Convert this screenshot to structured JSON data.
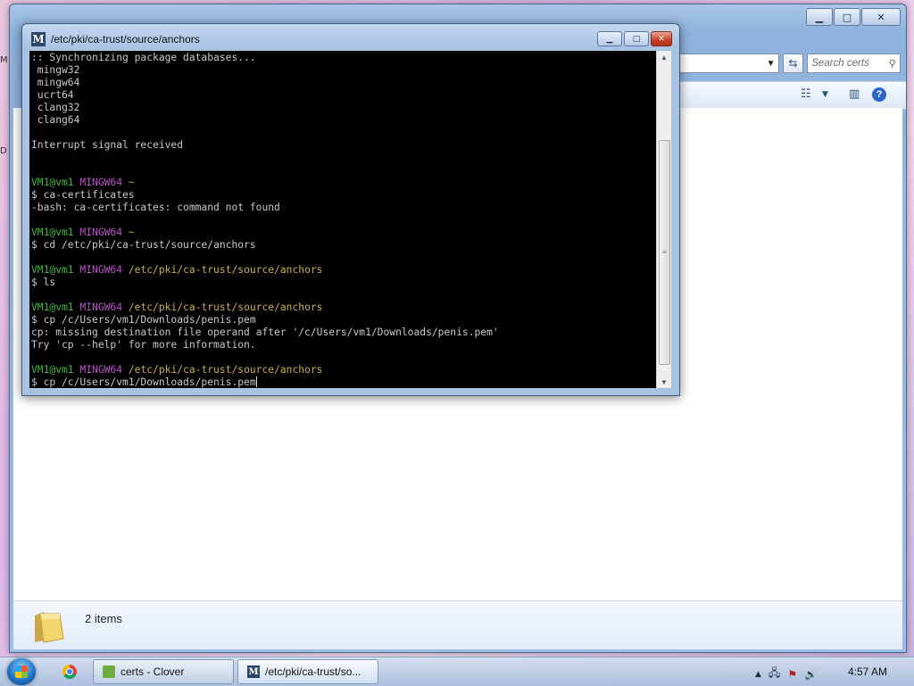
{
  "explorer": {
    "search_placeholder": "Search certs",
    "item_count": "2 items",
    "caption": {
      "minimize": "▁",
      "maximize": "□",
      "close": "✕"
    }
  },
  "terminal": {
    "title": "/etc/pki/ca-trust/source/anchors",
    "logo_letter": "M",
    "caption": {
      "minimize": "▁",
      "maximize": "□",
      "close": "✕"
    },
    "lines": [
      [
        {
          "t": ":: Synchronizing package databases...",
          "c": ""
        }
      ],
      [
        {
          "t": " mingw32",
          "c": ""
        }
      ],
      [
        {
          "t": " mingw64",
          "c": ""
        }
      ],
      [
        {
          "t": " ucrt64",
          "c": ""
        }
      ],
      [
        {
          "t": " clang32",
          "c": ""
        }
      ],
      [
        {
          "t": " clang64",
          "c": ""
        }
      ],
      [
        {
          "t": "",
          "c": ""
        }
      ],
      [
        {
          "t": "Interrupt signal received",
          "c": ""
        }
      ],
      [
        {
          "t": "",
          "c": ""
        }
      ],
      [
        {
          "t": "",
          "c": ""
        }
      ],
      [
        {
          "t": "VM1@vm1 ",
          "c": "green"
        },
        {
          "t": "MINGW64 ",
          "c": "magenta"
        },
        {
          "t": "~",
          "c": "yellow"
        }
      ],
      [
        {
          "t": "$ ca-certificates",
          "c": ""
        }
      ],
      [
        {
          "t": "-bash: ca-certificates: command not found",
          "c": ""
        }
      ],
      [
        {
          "t": "",
          "c": ""
        }
      ],
      [
        {
          "t": "VM1@vm1 ",
          "c": "green"
        },
        {
          "t": "MINGW64 ",
          "c": "magenta"
        },
        {
          "t": "~",
          "c": "yellow"
        }
      ],
      [
        {
          "t": "$ cd /etc/pki/ca-trust/source/anchors",
          "c": ""
        }
      ],
      [
        {
          "t": "",
          "c": ""
        }
      ],
      [
        {
          "t": "VM1@vm1 ",
          "c": "green"
        },
        {
          "t": "MINGW64 ",
          "c": "magenta"
        },
        {
          "t": "/etc/pki/ca-trust/source/anchors",
          "c": "yellow"
        }
      ],
      [
        {
          "t": "$ ls",
          "c": ""
        }
      ],
      [
        {
          "t": "",
          "c": ""
        }
      ],
      [
        {
          "t": "VM1@vm1 ",
          "c": "green"
        },
        {
          "t": "MINGW64 ",
          "c": "magenta"
        },
        {
          "t": "/etc/pki/ca-trust/source/anchors",
          "c": "yellow"
        }
      ],
      [
        {
          "t": "$ cp /c/Users/vm1/Downloads/penis.pem",
          "c": ""
        }
      ],
      [
        {
          "t": "cp: missing destination file operand after '/c/Users/vm1/Downloads/penis.pem'",
          "c": ""
        }
      ],
      [
        {
          "t": "Try 'cp --help' for more information.",
          "c": ""
        }
      ],
      [
        {
          "t": "",
          "c": ""
        }
      ],
      [
        {
          "t": "VM1@vm1 ",
          "c": "green"
        },
        {
          "t": "MINGW64 ",
          "c": "magenta"
        },
        {
          "t": "/etc/pki/ca-trust/source/anchors",
          "c": "yellow"
        }
      ],
      [
        {
          "t": "$ cp /c/Users/vm1/Downloads/penis.pem",
          "c": "",
          "cursor": true
        }
      ]
    ]
  },
  "taskbar": {
    "items": [
      {
        "label": "certs - Clover",
        "icon": "clover-icon"
      },
      {
        "label": "/etc/pki/ca-trust/so...",
        "icon": "mintty-icon"
      }
    ],
    "clock": "4:57 AM",
    "tray_icons": [
      "show-hidden-icon",
      "network-icon",
      "action-center-icon",
      "volume-icon"
    ]
  },
  "colors": {
    "prompt_user": "#3fb83f",
    "prompt_system": "#b854c6",
    "prompt_path": "#c8b043",
    "terminal_bg": "#000000",
    "terminal_fg": "#c8c8c8"
  }
}
